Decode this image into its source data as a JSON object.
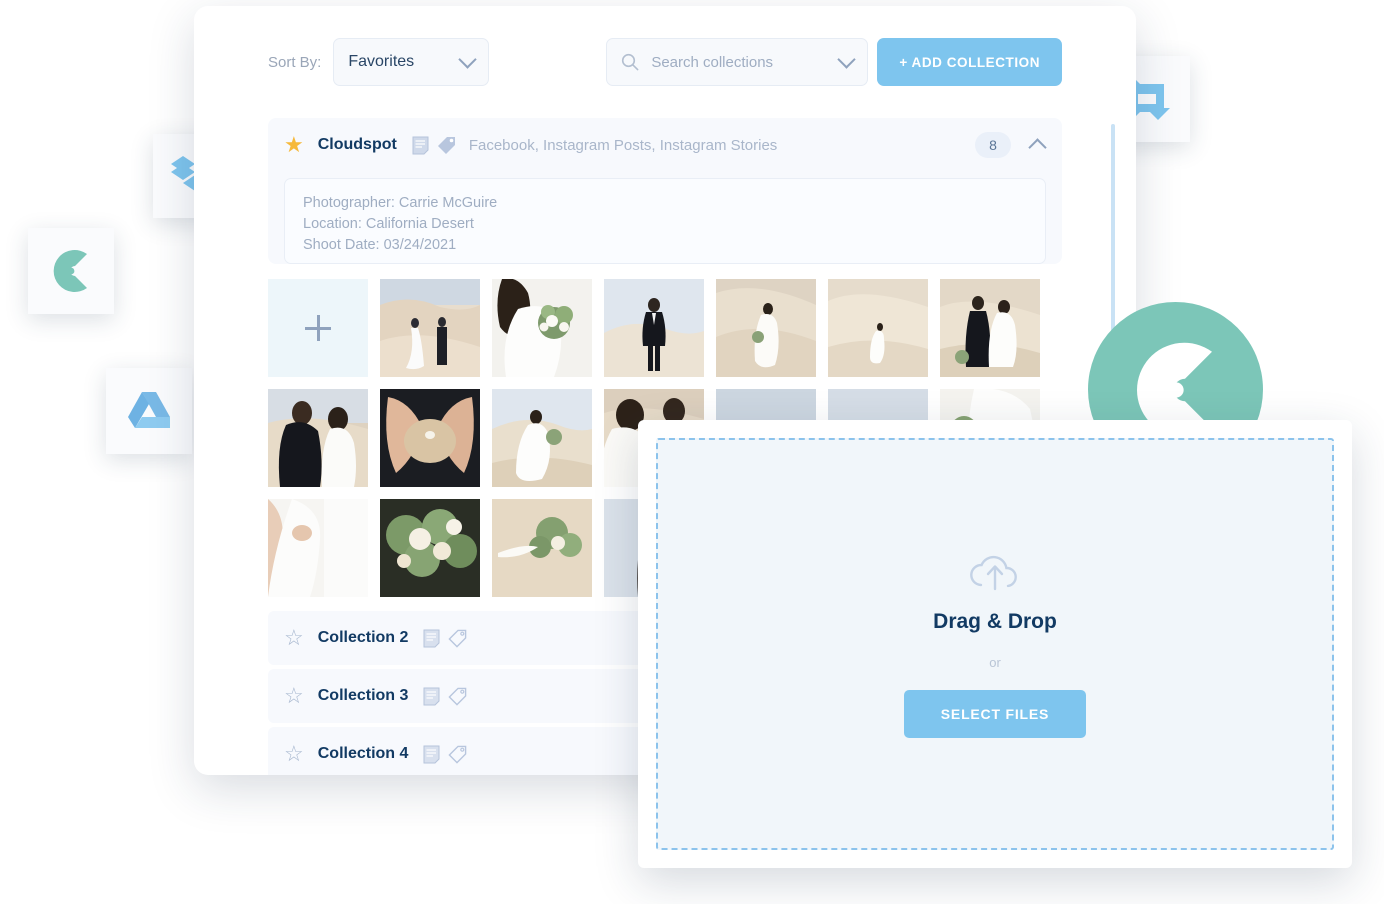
{
  "toolbar": {
    "sort_by_label": "Sort By:",
    "sort_value": "Favorites",
    "search_placeholder": "Search collections",
    "add_collection_label": "+ ADD COLLECTION"
  },
  "featured_collection": {
    "name": "Cloudspot",
    "tags": "Facebook, Instagram Posts, Instagram Stories",
    "count": "8",
    "starred": true,
    "meta": [
      "Photographer: Carrie McGuire",
      "Location: California Desert",
      "Shoot Date: 03/24/2021"
    ],
    "add_tile_label": "+",
    "photos": [
      {
        "alt": "bride and groom walking on dune holding hands"
      },
      {
        "alt": "bride holding white and green bouquet"
      },
      {
        "alt": "groom in black tuxedo standing on sand"
      },
      {
        "alt": "bride in white dress walking up dune"
      },
      {
        "alt": "bride with bouquet small on vast dune"
      },
      {
        "alt": "couple embracing on sand dune"
      },
      {
        "alt": "groom and bride facing each other closeup"
      },
      {
        "alt": "hands holding sand with ring"
      },
      {
        "alt": "bride standing on dune with dress flowing"
      },
      {
        "alt": "bride and groom portrait close up"
      },
      {
        "alt": "desert sky and dune landscape"
      },
      {
        "alt": "pale sky over dune"
      },
      {
        "alt": "bride dress detail with greenery"
      },
      {
        "alt": "bride arm and dress detail"
      },
      {
        "alt": "bridal bouquet of roses and eucalyptus"
      },
      {
        "alt": "bouquet lying on sand with ribbon"
      },
      {
        "alt": "bride hair detail"
      }
    ]
  },
  "collections": [
    {
      "name": "Collection 2",
      "starred": false
    },
    {
      "name": "Collection 3",
      "starred": false
    },
    {
      "name": "Collection 4",
      "starred": false
    }
  ],
  "upload_panel": {
    "title": "Drag & Drop",
    "or_label": "or",
    "select_files_label": "SELECT FILES"
  },
  "integrations": [
    {
      "name": "Dropbox"
    },
    {
      "name": "CloudSpot"
    },
    {
      "name": "Google Drive"
    },
    {
      "name": "Sync"
    }
  ],
  "colors": {
    "accent_blue": "#7ec5ee",
    "brand_teal": "#7cc6b8",
    "navy_text": "#123a63",
    "muted_text": "#a9b6ca",
    "star_gold": "#f6b93b",
    "panel_bg": "#f7f9fd",
    "dropzone_bg": "#f1f6fa"
  }
}
